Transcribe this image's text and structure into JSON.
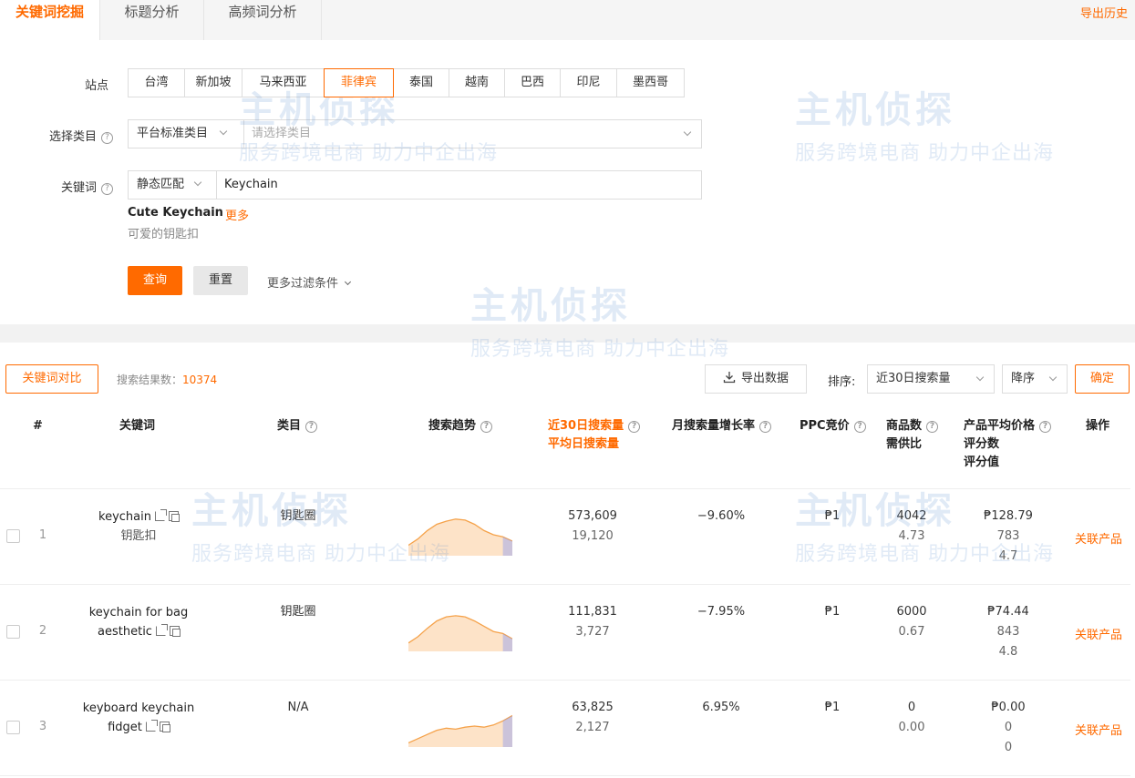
{
  "tabs": [
    "关键词挖掘",
    "标题分析",
    "高频词分析"
  ],
  "export_history": "导出历史",
  "filters": {
    "site_label": "站点",
    "sites": [
      "台湾",
      "新加坡",
      "马来西亚",
      "菲律宾",
      "泰国",
      "越南",
      "巴西",
      "印尼",
      "墨西哥"
    ],
    "active_site": "菲律宾",
    "category_label": "选择类目",
    "category_type": "平台标准类目",
    "category_placeholder": "请选择类目",
    "keyword_label": "关键词",
    "match_type": "静态匹配",
    "keyword_value": "Keychain",
    "suggestion_en": "Cute Keychain",
    "suggestion_more": "更多",
    "suggestion_cn": "可爱的钥匙扣",
    "query_button": "查询",
    "reset_button": "重置",
    "more_filters": "更多过滤条件"
  },
  "toolbar": {
    "compare_button": "关键词对比",
    "result_label": "搜索结果数：",
    "result_count": "10374",
    "export_button": "导出数据",
    "sort_label": "排序:",
    "sort_field": "近30日搜索量",
    "sort_order": "降序",
    "confirm_button": "确定"
  },
  "table": {
    "headers": {
      "index": "#",
      "keyword": "关键词",
      "category": "类目",
      "trend": "搜索趋势",
      "search30": "近30日搜索量",
      "daily": "平均日搜索量",
      "growth": "月搜索量增长率",
      "ppc": "PPC竞价",
      "products": "商品数",
      "ratio": "需供比",
      "avg_price": "产品平均价格",
      "reviews": "评分数",
      "rating": "评分值",
      "action": "操作"
    },
    "rows": [
      {
        "index": "1",
        "kw_line1": "keychain",
        "kw_line2": "钥匙扣",
        "category": "钥匙圈",
        "search30": "573,609",
        "daily": "19,120",
        "growth": "−9.60%",
        "ppc": "₱1",
        "products": "4042",
        "ratio": "4.73",
        "price": "₱128.79",
        "reviews": "783",
        "rating": "4.7",
        "action": "关联产品",
        "trend": [
          10,
          16,
          24,
          30,
          33,
          35,
          34,
          30,
          24,
          20,
          18,
          14
        ]
      },
      {
        "index": "2",
        "kw_line1": "keychain for bag",
        "kw_line2": "aesthetic",
        "category": "钥匙圈",
        "search30": "111,831",
        "daily": "3,727",
        "growth": "−7.95%",
        "ppc": "₱1",
        "products": "6000",
        "ratio": "0.67",
        "price": "₱74.44",
        "reviews": "843",
        "rating": "4.8",
        "action": "关联产品",
        "trend": [
          8,
          14,
          22,
          29,
          33,
          34,
          33,
          29,
          24,
          19,
          17,
          12
        ]
      },
      {
        "index": "3",
        "kw_line1": "keyboard keychain",
        "kw_line2": "fidget",
        "category": "N/A",
        "search30": "63,825",
        "daily": "2,127",
        "growth": "6.95%",
        "ppc": "₱1",
        "products": "0",
        "ratio": "0.00",
        "price": "₱0.00",
        "reviews": "0",
        "rating": "0",
        "action": "关联产品",
        "trend": [
          4,
          8,
          12,
          16,
          18,
          17,
          19,
          20,
          19,
          21,
          25,
          30
        ]
      }
    ]
  },
  "watermark": {
    "brand": "主机侦探",
    "slogan": "服务跨境电商 助力中企出海"
  },
  "colors": {
    "accent": "#ff6a00",
    "trend_line": "#f5a24a",
    "trend_fill": "#fde3c8",
    "trend_tail": "#8f9bf0"
  }
}
